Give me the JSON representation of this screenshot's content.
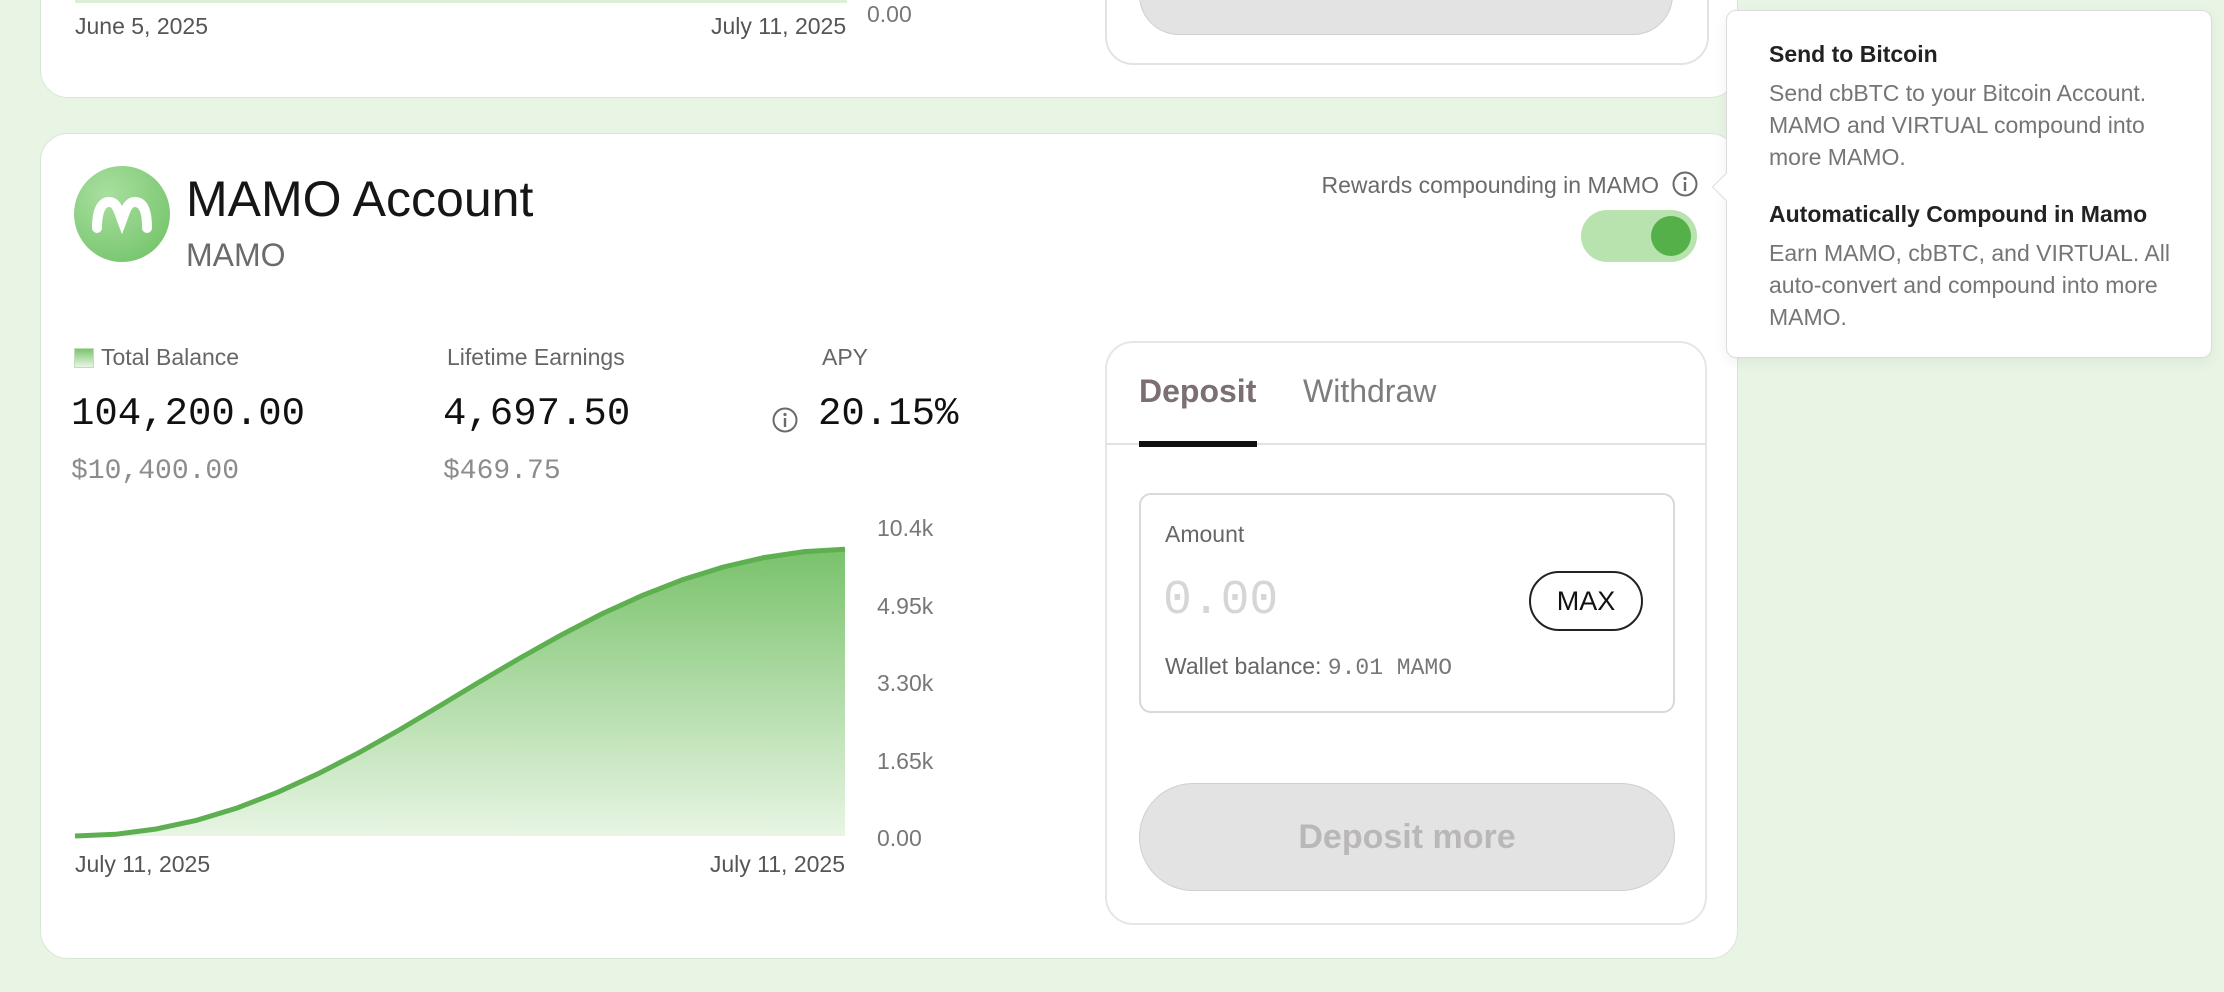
{
  "top_card": {
    "date_start": "June 5, 2025",
    "date_end": "July 11, 2025",
    "axis_zero": "0.00"
  },
  "account": {
    "title": "MAMO Account",
    "ticker": "MAMO",
    "logo_icon": "mamo-logo-icon",
    "compound_label": "Rewards compounding in MAMO",
    "compound_enabled": true
  },
  "stats": {
    "total_balance_label": "Total Balance",
    "total_balance_value": "104,200.00",
    "total_balance_fiat": "$10,400.00",
    "lifetime_label": "Lifetime Earnings",
    "lifetime_value": "4,697.50",
    "lifetime_fiat": "$469.75",
    "apy_label": "APY",
    "apy_value": "20.15%"
  },
  "chart_data": {
    "type": "area",
    "x": [
      "July 11, 2025",
      "July 11, 2025"
    ],
    "x_tick_labels": [
      "July 11, 2025",
      "July 11, 2025"
    ],
    "y_tick_labels": [
      "10.4k",
      "4.95k",
      "3.30k",
      "1.65k",
      "0.00"
    ],
    "series": [
      {
        "values": [
          0,
          50,
          200,
          450,
          800,
          1250,
          1780,
          2380,
          3030,
          3720,
          4420,
          5100,
          5750,
          6350,
          6880,
          7330,
          7690,
          7960,
          8130,
          8200
        ]
      }
    ],
    "grid": false,
    "colors": {
      "line": "#5daf50",
      "fill_top": "#79c26b",
      "fill_bottom": "#e8f5e4"
    }
  },
  "panel": {
    "tab_deposit": "Deposit",
    "tab_withdraw": "Withdraw",
    "amount_label": "Amount",
    "amount_placeholder": "0.00",
    "max_label": "MAX",
    "wallet_label": "Wallet balance:",
    "wallet_value": "9.01 MAMO",
    "deposit_button": "Deposit more"
  },
  "tooltip": {
    "title1": "Send to Bitcoin",
    "body1": "Send cbBTC to your Bitcoin Account. MAMO and VIRTUAL compound into more MAMO.",
    "title2": "Automatically Compound in Mamo",
    "body2": "Earn MAMO, cbBTC, and VIRTUAL. All auto-convert and compound into more MAMO."
  },
  "colors": {
    "background": "#e8f5e4",
    "accent_green": "#56b04a",
    "toggle_track": "#b8e3ae"
  }
}
